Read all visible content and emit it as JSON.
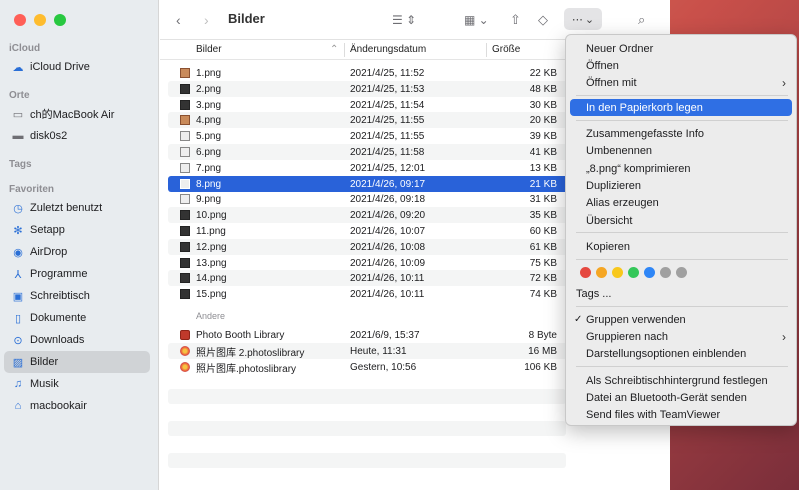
{
  "window": {
    "title": "Bilder"
  },
  "colors": {
    "close": "#ff5f57",
    "minimize": "#febc2e",
    "zoom": "#28c840",
    "selection": "#2962d9",
    "highlight": "#2f6fe4"
  },
  "sidebar": {
    "sections": {
      "icloud": "iCloud",
      "orte": "Orte",
      "tags": "Tags",
      "favoriten": "Favoriten"
    },
    "icloud_items": [
      {
        "label": "iCloud Drive",
        "icon": "cloud-icon"
      }
    ],
    "orte_items": [
      {
        "label": "ch的MacBook Air",
        "icon": "laptop-icon"
      },
      {
        "label": "disk0s2",
        "icon": "disk-icon"
      }
    ],
    "favoriten_items": [
      {
        "label": "Zuletzt benutzt",
        "icon": "clock-icon"
      },
      {
        "label": "Setapp",
        "icon": "setapp-icon"
      },
      {
        "label": "AirDrop",
        "icon": "airdrop-icon"
      },
      {
        "label": "Programme",
        "icon": "apps-icon"
      },
      {
        "label": "Schreibtisch",
        "icon": "desktop-icon"
      },
      {
        "label": "Dokumente",
        "icon": "document-icon"
      },
      {
        "label": "Downloads",
        "icon": "download-icon"
      },
      {
        "label": "Bilder",
        "icon": "photo-icon"
      },
      {
        "label": "Musik",
        "icon": "music-icon"
      },
      {
        "label": "macbookair",
        "icon": "home-icon"
      }
    ]
  },
  "columns": {
    "name": "Bilder",
    "date": "Änderungsdatum",
    "size": "Größe"
  },
  "files": [
    {
      "name": "1.png",
      "date": "2021/4/25, 11:52",
      "size": "22 KB"
    },
    {
      "name": "2.png",
      "date": "2021/4/25, 11:53",
      "size": "48 KB"
    },
    {
      "name": "3.png",
      "date": "2021/4/25, 11:54",
      "size": "30 KB"
    },
    {
      "name": "4.png",
      "date": "2021/4/25, 11:55",
      "size": "20 KB"
    },
    {
      "name": "5.png",
      "date": "2021/4/25, 11:55",
      "size": "39 KB"
    },
    {
      "name": "6.png",
      "date": "2021/4/25, 11:58",
      "size": "41 KB"
    },
    {
      "name": "7.png",
      "date": "2021/4/25, 12:01",
      "size": "13 KB"
    },
    {
      "name": "8.png",
      "date": "2021/4/26, 09:17",
      "size": "21 KB"
    },
    {
      "name": "9.png",
      "date": "2021/4/26, 09:18",
      "size": "31 KB"
    },
    {
      "name": "10.png",
      "date": "2021/4/26, 09:20",
      "size": "35 KB"
    },
    {
      "name": "11.png",
      "date": "2021/4/26, 10:07",
      "size": "60 KB"
    },
    {
      "name": "12.png",
      "date": "2021/4/26, 10:08",
      "size": "61 KB"
    },
    {
      "name": "13.png",
      "date": "2021/4/26, 10:09",
      "size": "75 KB"
    },
    {
      "name": "14.png",
      "date": "2021/4/26, 10:11",
      "size": "72 KB"
    },
    {
      "name": "15.png",
      "date": "2021/4/26, 10:11",
      "size": "74 KB"
    }
  ],
  "other_group": {
    "label": "Andere",
    "files": [
      {
        "name": "Photo Booth Library",
        "date": "2021/6/9, 15:37",
        "size": "8 Byte"
      },
      {
        "name": "照片图库 2.photoslibrary",
        "date": "Heute, 11:31",
        "size": "16 MB"
      },
      {
        "name": "照片图库.photoslibrary",
        "date": "Gestern, 10:56",
        "size": "106 KB"
      }
    ]
  },
  "context_menu": {
    "items": [
      "Neuer Ordner",
      "Öffnen",
      "Öffnen mit",
      "In den Papierkorb legen",
      "Zusammengefasste Info",
      "Umbenennen",
      "„8.png“ komprimieren",
      "Duplizieren",
      "Alias erzeugen",
      "Übersicht",
      "Kopieren",
      "Tags ...",
      "Gruppen verwenden",
      "Gruppieren nach",
      "Darstellungsoptionen einblenden",
      "Als Schreibtischhintergrund festlegen",
      "Datei an Bluetooth-Gerät senden",
      "Send files with TeamViewer"
    ],
    "tag_colors": [
      "#e5483f",
      "#f5a623",
      "#f8c81c",
      "#34c759",
      "#2f86f6",
      "#a0a0a0",
      "#a0a0a0"
    ]
  }
}
